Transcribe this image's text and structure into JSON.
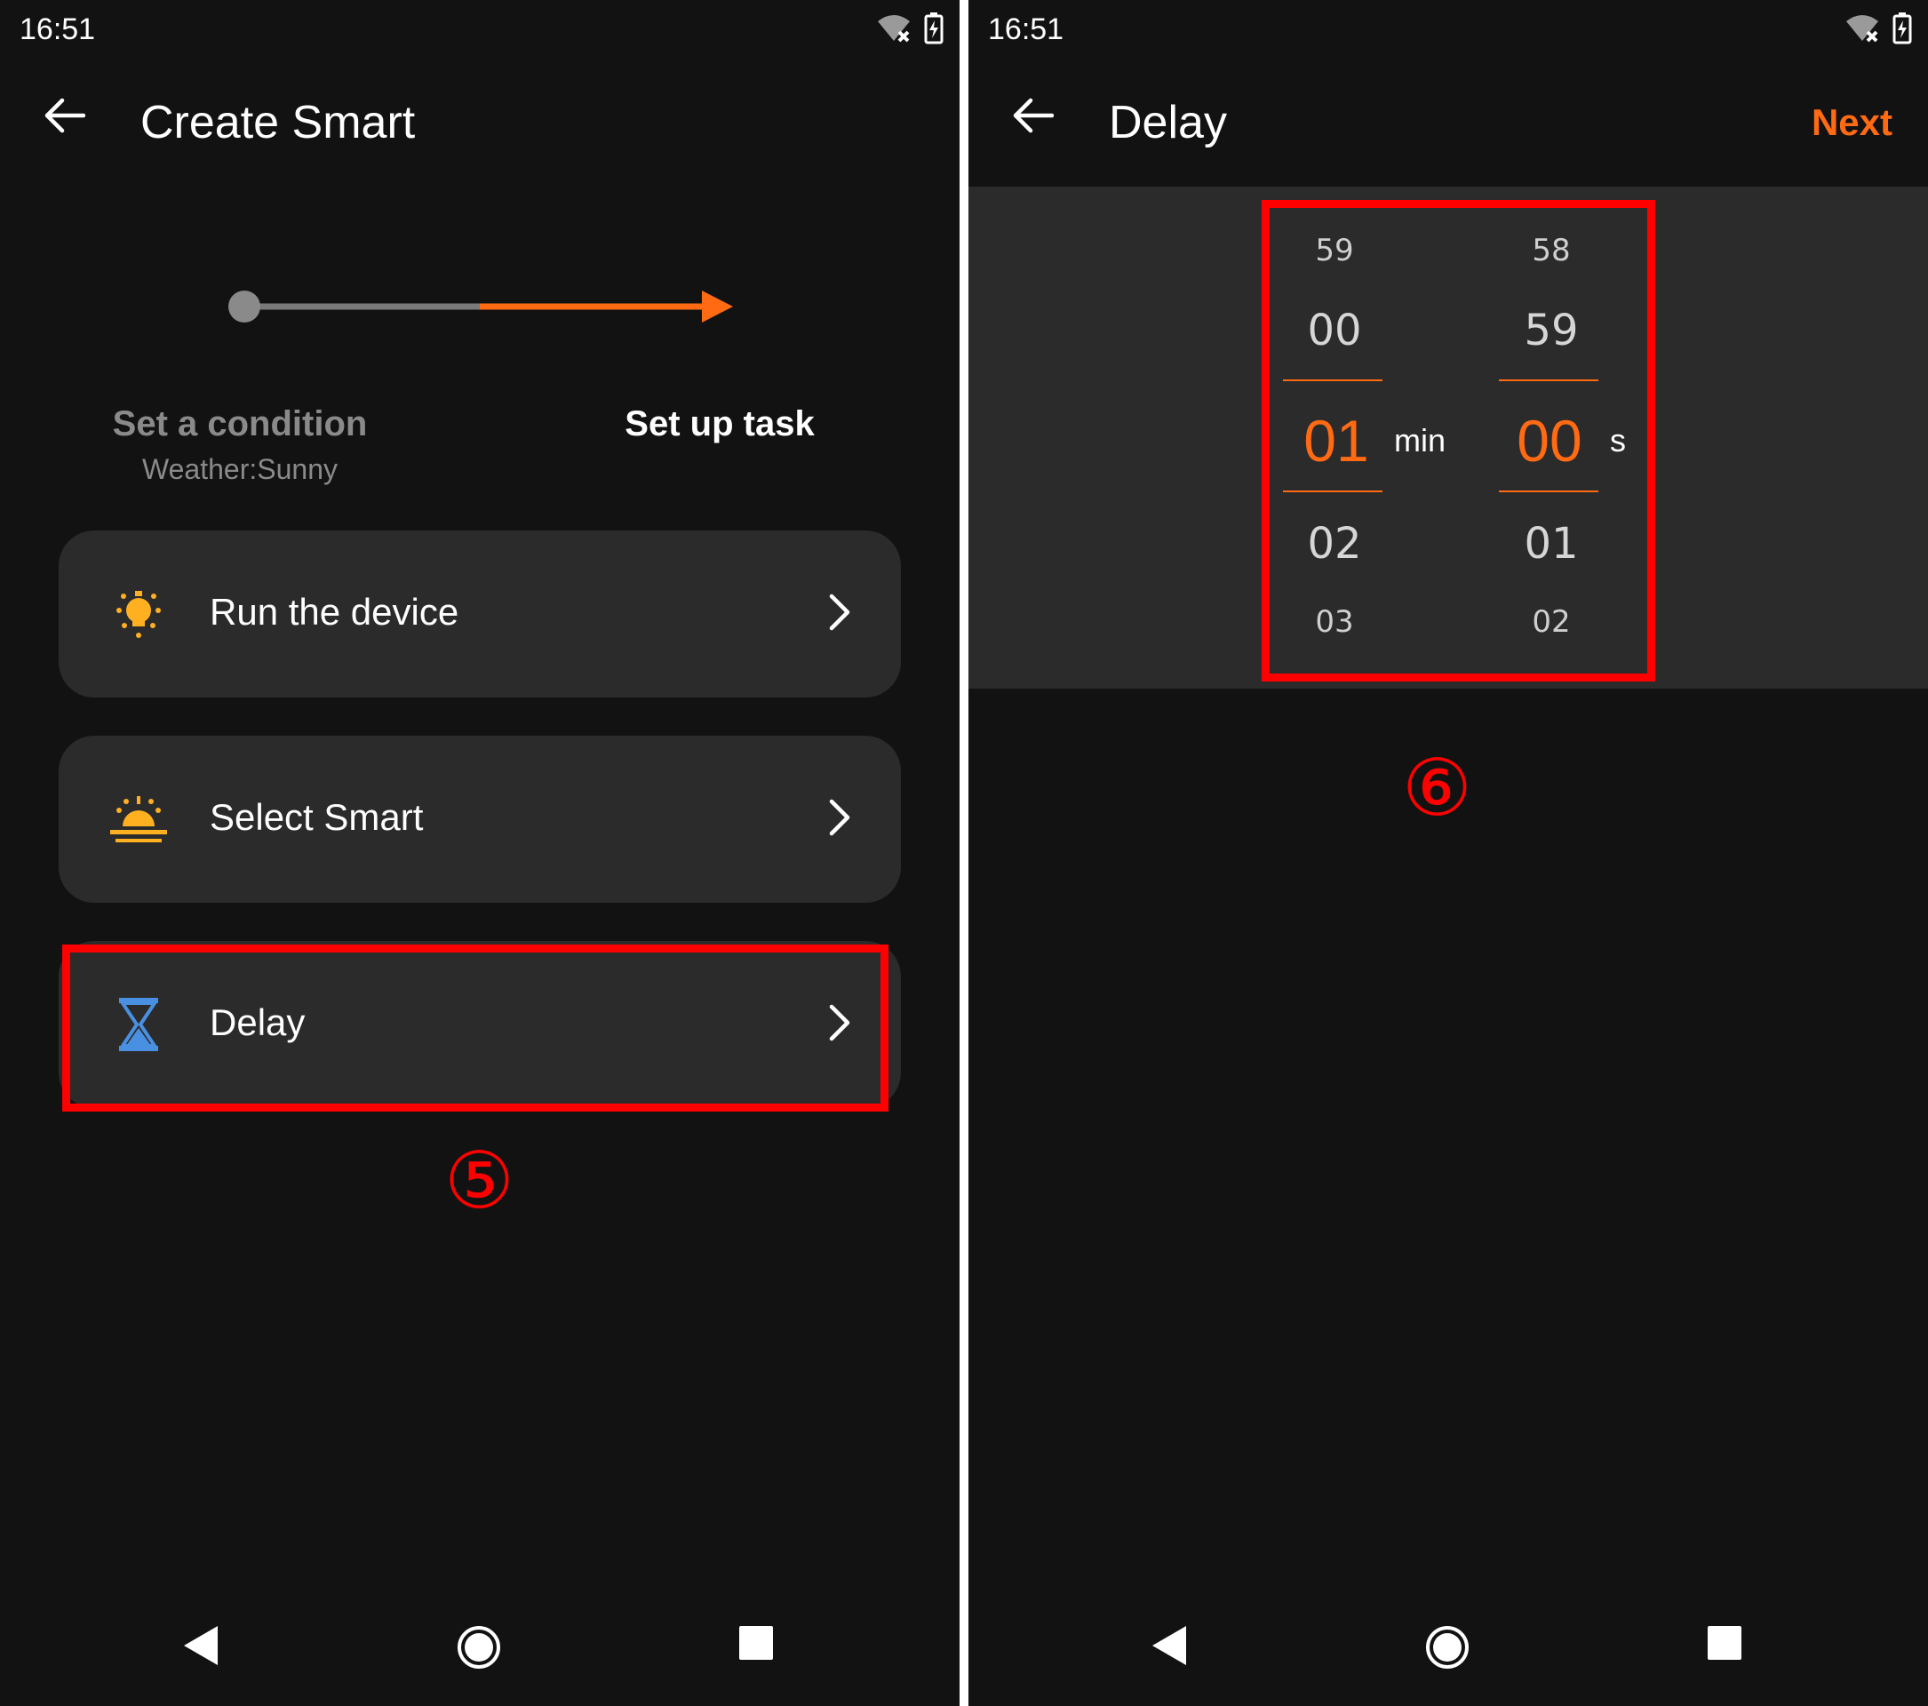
{
  "left": {
    "status_time": "16:51",
    "title": "Create Smart",
    "progress": {
      "condition_label": "Set a condition",
      "condition_value": "Weather:Sunny",
      "task_label": "Set up task"
    },
    "items": [
      {
        "label": "Run the device"
      },
      {
        "label": "Select Smart"
      },
      {
        "label": "Delay"
      }
    ],
    "step_marker": "⑤"
  },
  "right": {
    "status_time": "16:51",
    "title": "Delay",
    "next_label": "Next",
    "minutes": {
      "above2": "59",
      "above1": "00",
      "selected": "01",
      "below1": "02",
      "below2": "03",
      "unit": "min"
    },
    "seconds": {
      "above2": "58",
      "above1": "59",
      "selected": "00",
      "below1": "01",
      "below2": "02",
      "unit": "s"
    },
    "step_marker": "⑥"
  },
  "colors": {
    "accent": "#ff6a13",
    "highlight": "#ff0000",
    "card": "#2b2b2b",
    "background": "#121212"
  }
}
